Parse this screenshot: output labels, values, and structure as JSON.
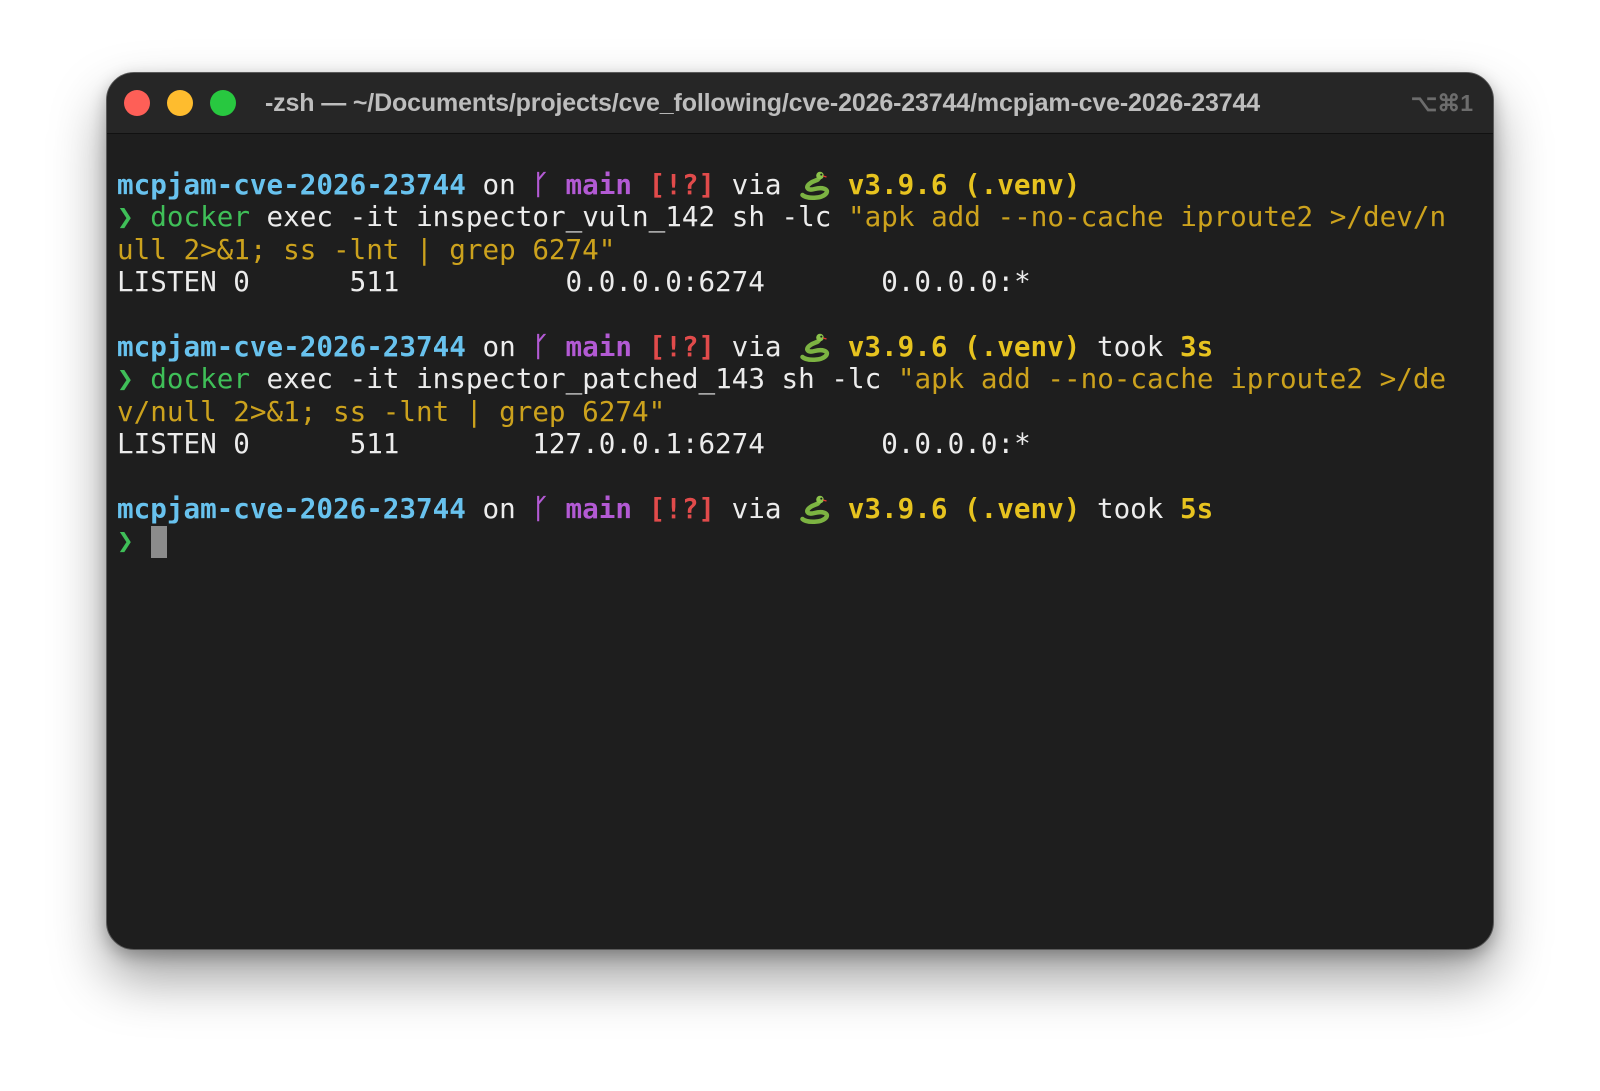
{
  "window": {
    "title": "-zsh — ~/Documents/projects/cve_following/cve-2026-23744/mcpjam-cve-2026-23744",
    "shortcut": "⌥⌘1"
  },
  "prompt": {
    "dir": "mcpjam-cve-2026-23744",
    "on": " on ",
    "git_icon": "ᚴ",
    "branch": "main",
    "status": "[!?]",
    "via": " via ",
    "python": "v3.9.6 (.venv)",
    "took_word": " took ",
    "char": "❯"
  },
  "blocks": [
    {
      "took": "",
      "cmd_name": "docker",
      "cmd_args": " exec -it inspector_vuln_142 sh -lc ",
      "cmd_str_1": "\"apk add --no-cache iproute2 >/dev/n",
      "cmd_str_2": "ull 2>&1; ss -lnt | grep 6274\"",
      "output": "LISTEN 0      511          0.0.0.0:6274       0.0.0.0:*"
    },
    {
      "took": "3s",
      "cmd_name": "docker",
      "cmd_args": " exec -it inspector_patched_143 sh -lc ",
      "cmd_str_1": "\"apk add --no-cache iproute2 >/de",
      "cmd_str_2": "v/null 2>&1; ss -lnt | grep 6274\"",
      "output": "LISTEN 0      511        127.0.0.1:6274       0.0.0.0:*"
    },
    {
      "took": "5s"
    }
  ],
  "colors": {
    "background": "#1e1e1e",
    "dir": "#68c2ee",
    "branch": "#b35ad4",
    "status": "#e14b4b",
    "python": "#e7c31f",
    "command": "#3fbf58",
    "string": "#cca21d"
  },
  "icons": {
    "git": "git-branch-icon",
    "python": "snake-icon"
  }
}
